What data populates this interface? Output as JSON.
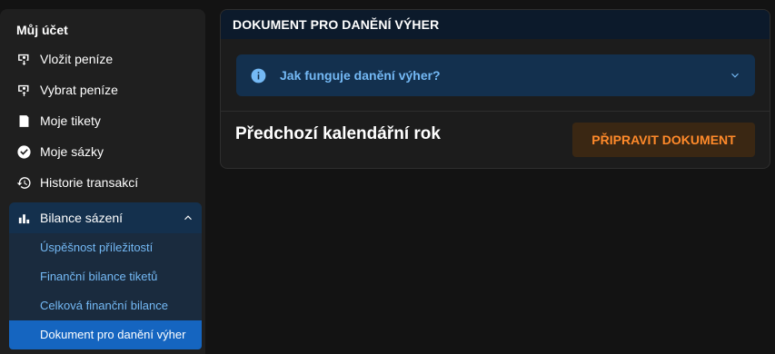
{
  "sidebar": {
    "title": "Můj účet",
    "items": [
      {
        "label": "Vložit peníze",
        "icon": "deposit-icon"
      },
      {
        "label": "Vybrat peníze",
        "icon": "withdraw-icon"
      },
      {
        "label": "Moje tikety",
        "icon": "tickets-icon"
      },
      {
        "label": "Moje sázky",
        "icon": "check-circle-icon"
      },
      {
        "label": "Historie transakcí",
        "icon": "history-icon"
      }
    ],
    "group": {
      "label": "Bilance sázení",
      "icon": "bar-chart-icon",
      "expanded": true,
      "sub_items": [
        {
          "label": "Úspěšnost příležitostí"
        },
        {
          "label": "Finanční bilance tiketů"
        },
        {
          "label": "Celková finanční bilance"
        },
        {
          "label": "Dokument pro danění výher",
          "active": true
        }
      ]
    }
  },
  "panel": {
    "title": "DOKUMENT PRO DANĚNÍ VÝHER",
    "accordion_label": "Jak funguje danění výher?",
    "row_label": "Předchozí kalendářní rok",
    "button_label": "PŘIPRAVIT DOKUMENT"
  },
  "colors": {
    "background": "#131313",
    "sidebar": "#1f1f1f",
    "active_item": "#1565c0",
    "link_blue": "#74b9f5",
    "accent_orange": "#ff8a2a"
  }
}
